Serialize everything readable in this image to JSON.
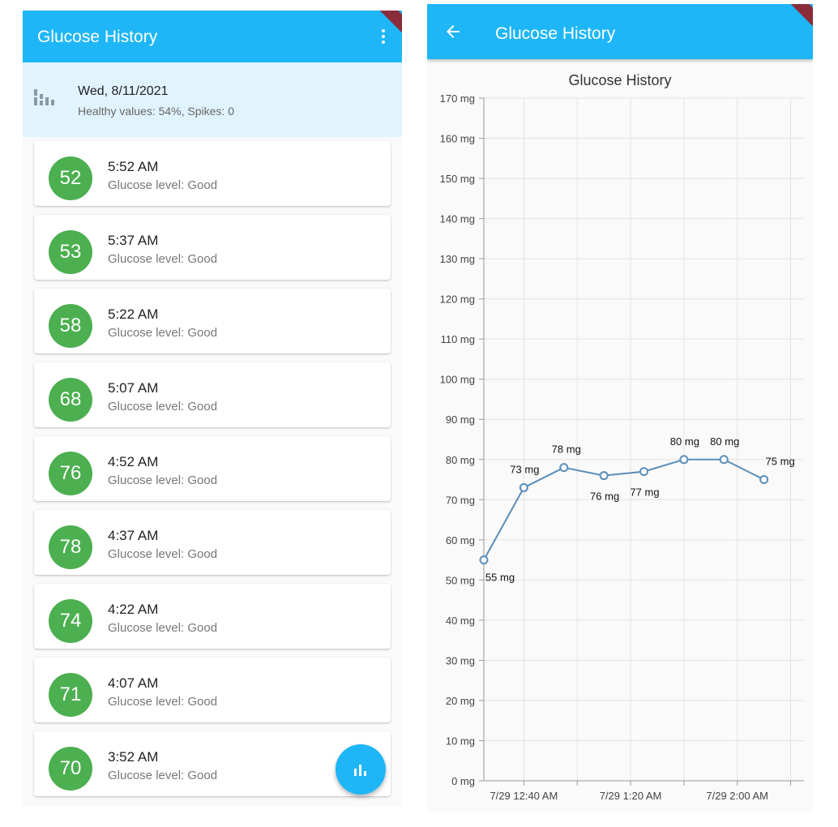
{
  "left": {
    "appbar": {
      "title": "Glucose History",
      "menu_icon": "more-vert-icon"
    },
    "debug_banner": "DEBUG",
    "summary": {
      "icon": "bar-chart-icon",
      "date": "Wed, 8/11/2021",
      "stats": "Healthy values: 54%, Spikes: 0"
    },
    "readings": [
      {
        "value": "52",
        "time": "5:52 AM",
        "level": "Glucose level: Good"
      },
      {
        "value": "53",
        "time": "5:37 AM",
        "level": "Glucose level: Good"
      },
      {
        "value": "58",
        "time": "5:22 AM",
        "level": "Glucose level: Good"
      },
      {
        "value": "68",
        "time": "5:07 AM",
        "level": "Glucose level: Good"
      },
      {
        "value": "76",
        "time": "4:52 AM",
        "level": "Glucose level: Good"
      },
      {
        "value": "78",
        "time": "4:37 AM",
        "level": "Glucose level: Good"
      },
      {
        "value": "74",
        "time": "4:22 AM",
        "level": "Glucose level: Good"
      },
      {
        "value": "71",
        "time": "4:07 AM",
        "level": "Glucose level: Good"
      },
      {
        "value": "70",
        "time": "3:52 AM",
        "level": "Glucose level: Good"
      }
    ],
    "fab_icon": "insights-chart-icon"
  },
  "right": {
    "appbar": {
      "title": "Glucose History",
      "back_icon": "arrow-back-icon"
    },
    "debug_banner": "DEBUG"
  },
  "colors": {
    "primary": "#1eb6f7",
    "good": "#4caf50",
    "summary_bg": "#e1f3fd",
    "line": "#5b8db8",
    "debug": "#8b2c3b"
  },
  "chart_data": {
    "type": "line",
    "title": "Glucose History",
    "ylim": [
      0,
      170
    ],
    "yticks": [
      0,
      10,
      20,
      30,
      40,
      50,
      60,
      70,
      80,
      90,
      100,
      110,
      120,
      130,
      140,
      150,
      160,
      170
    ],
    "ytick_suffix": " mg",
    "xlim": [
      "7/29 12:25 AM",
      "7/29 2:25 AM"
    ],
    "xtick_labels": [
      "7/29 12:40 AM",
      "7/29 1:20 AM",
      "7/29 2:00 AM"
    ],
    "x_minutes_from_midnight": [
      25,
      40,
      55,
      70,
      85,
      100,
      115,
      130,
      145
    ],
    "xtick_minutes": [
      40,
      80,
      120
    ],
    "xlim_minutes": [
      25,
      145
    ],
    "grid": true,
    "series": [
      {
        "values": [
          55,
          73,
          78,
          76,
          77,
          80,
          80,
          75
        ],
        "labels": [
          "55 mg",
          "73 mg",
          "78 mg",
          "76 mg",
          "77 mg",
          "80 mg",
          "80 mg",
          "75 mg"
        ]
      }
    ]
  }
}
